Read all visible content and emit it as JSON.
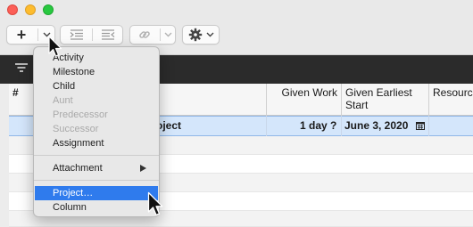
{
  "toolbar": {
    "add_label": "+",
    "add_menu_chevron": "chevron-down-icon",
    "indent_icon": "indent-icon",
    "outdent_icon": "outdent-icon",
    "link_icon": "link-icon",
    "settings_icon": "gear-icon"
  },
  "table": {
    "columns": [
      "#",
      "",
      "Given Work",
      "Given Earliest\nStart",
      "Resourc"
    ],
    "col_hash": "#",
    "col_given_work": "Given Work",
    "col_earliest_start_line1": "Given Earliest",
    "col_earliest_start_line2": "Start",
    "col_resources": "Resourc",
    "selected_row": {
      "title": "oject",
      "given_work": "1 day ?",
      "earliest_start": "June 3, 2020"
    }
  },
  "add_menu": {
    "items": [
      {
        "label": "Activity",
        "enabled": true
      },
      {
        "label": "Milestone",
        "enabled": true
      },
      {
        "label": "Child",
        "enabled": true
      },
      {
        "label": "Aunt",
        "enabled": false
      },
      {
        "label": "Predecessor",
        "enabled": false
      },
      {
        "label": "Successor",
        "enabled": false
      },
      {
        "label": "Assignment",
        "enabled": true
      },
      {
        "label": "Attachment",
        "enabled": true,
        "submenu": true
      },
      {
        "label": "Project…",
        "enabled": true,
        "highlighted": true
      },
      {
        "label": "Column",
        "enabled": true
      }
    ]
  },
  "colors": {
    "menu_highlight": "#2f7bed",
    "selected_row": "#d4e6fb",
    "toolbar_dark": "#2b2b2b"
  }
}
